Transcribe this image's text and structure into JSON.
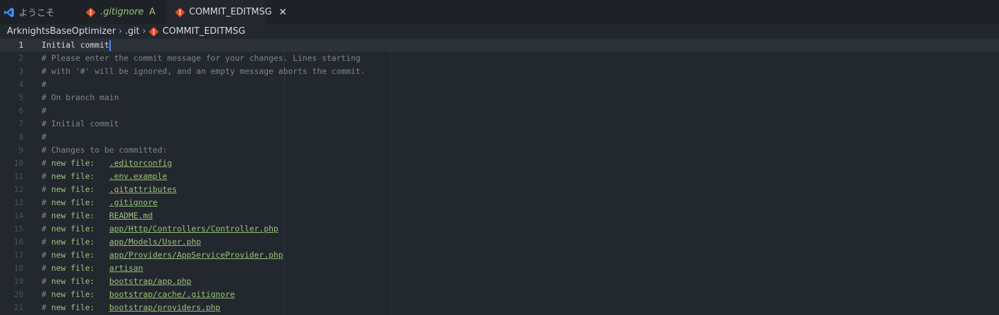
{
  "tabs": [
    {
      "label": "ようこそ"
    },
    {
      "label": ".gitignore",
      "status": "A"
    },
    {
      "label": "COMMIT_EDITMSG",
      "close": "✕"
    }
  ],
  "breadcrumb": [
    "ArknightsBaseOptimizer",
    ".git",
    "COMMIT_EDITMSG"
  ],
  "colors": {
    "git_icon": "#e44d26",
    "vscode_icon": "#3794ff",
    "added": "#98c379"
  },
  "lines": [
    {
      "n": "1",
      "text": "Initial commit"
    },
    {
      "n": "2",
      "text": "# Please enter the commit message for your changes. Lines starting"
    },
    {
      "n": "3",
      "text": "# with '#' will be ignored, and an empty message aborts the commit."
    },
    {
      "n": "4",
      "text": "#"
    },
    {
      "n": "5",
      "text": "# On branch main"
    },
    {
      "n": "6",
      "text": "#"
    },
    {
      "n": "7",
      "text": "# Initial commit"
    },
    {
      "n": "8",
      "text": "#"
    },
    {
      "n": "9",
      "text": "# Changes to be committed:"
    },
    {
      "n": "10",
      "prefix": "# new file:   ",
      "file": ".editorconfig"
    },
    {
      "n": "11",
      "prefix": "# new file:   ",
      "file": ".env.example"
    },
    {
      "n": "12",
      "prefix": "# new file:   ",
      "file": ".gitattributes"
    },
    {
      "n": "13",
      "prefix": "# new file:   ",
      "file": ".gitignore"
    },
    {
      "n": "14",
      "prefix": "# new file:   ",
      "file": "README.md"
    },
    {
      "n": "15",
      "prefix": "# new file:   ",
      "file": "app/Http/Controllers/Controller.php"
    },
    {
      "n": "16",
      "prefix": "# new file:   ",
      "file": "app/Models/User.php"
    },
    {
      "n": "17",
      "prefix": "# new file:   ",
      "file": "app/Providers/AppServiceProvider.php"
    },
    {
      "n": "18",
      "prefix": "# new file:   ",
      "file": "artisan"
    },
    {
      "n": "19",
      "prefix": "# new file:   ",
      "file": "bootstrap/app.php"
    },
    {
      "n": "20",
      "prefix": "# new file:   ",
      "file": "bootstrap/cache/.gitignore"
    },
    {
      "n": "21",
      "prefix": "# new file:   ",
      "file": "bootstrap/providers.php"
    }
  ]
}
